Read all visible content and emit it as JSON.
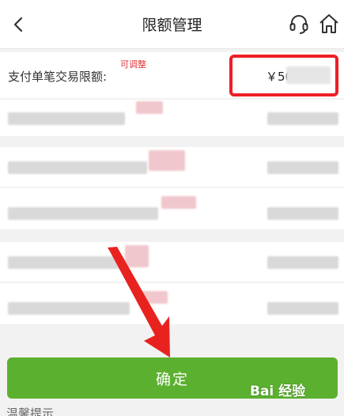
{
  "header": {
    "title": "限额管理",
    "back_icon": "chevron-left-icon",
    "service_icon": "headset-icon",
    "home_icon": "home-icon"
  },
  "limit_row": {
    "label": "支付单笔交易限额:",
    "tag": "可调整",
    "value": "￥50"
  },
  "confirm_button": {
    "label": "确定"
  },
  "watermark": {
    "text": "Bai 经验"
  },
  "bottom": {
    "text": "温馨提示"
  },
  "colors": {
    "accent_green": "#5cb030",
    "highlight_red": "#ee1e26",
    "arrow_red": "#e8231f",
    "tag_red": "#e0323a"
  }
}
